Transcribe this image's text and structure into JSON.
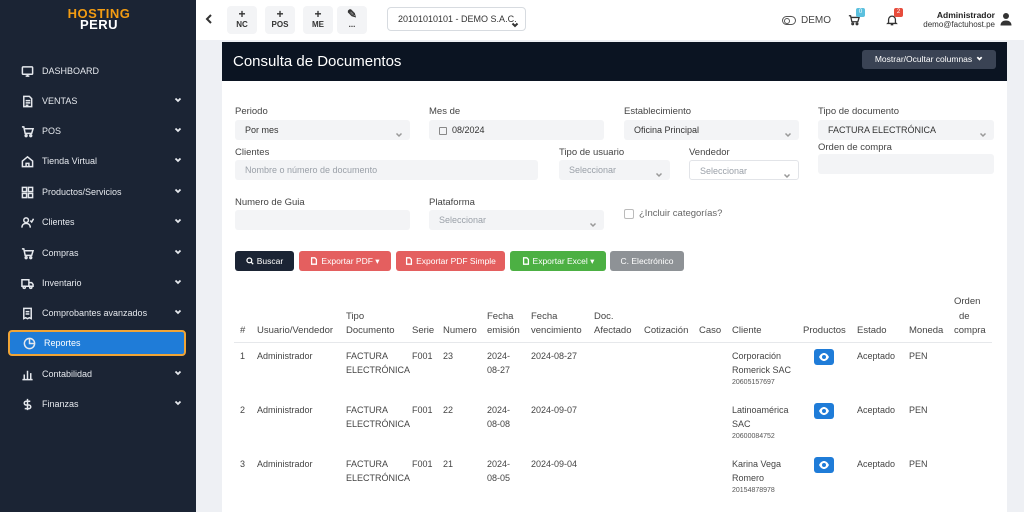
{
  "logo": {
    "line1": "HOSTING",
    "line2": "PERU"
  },
  "sidebar": {
    "items": [
      {
        "label": "DASHBOARD",
        "icon": "dashboard-icon"
      },
      {
        "label": "VENTAS",
        "icon": "document-icon"
      },
      {
        "label": "POS",
        "icon": "cart-icon"
      },
      {
        "label": "Tienda Virtual",
        "icon": "store-icon"
      },
      {
        "label": "Productos/Servicios",
        "icon": "grid-icon"
      },
      {
        "label": "Clientes",
        "icon": "users-icon"
      },
      {
        "label": "Compras",
        "icon": "cart-icon"
      },
      {
        "label": "Inventario",
        "icon": "truck-icon"
      },
      {
        "label": "Comprobantes avanzados",
        "icon": "receipt-icon"
      },
      {
        "label": "Reportes",
        "icon": "pie-chart-icon"
      },
      {
        "label": "Contabilidad",
        "icon": "bar-chart-icon"
      },
      {
        "label": "Finanzas",
        "icon": "dollar-icon"
      }
    ]
  },
  "topbar": {
    "quick": [
      {
        "plus": "+",
        "label": "NC"
      },
      {
        "plus": "+",
        "label": "POS"
      },
      {
        "plus": "+",
        "label": "ME"
      },
      {
        "plus": "✎",
        "label": "..."
      }
    ],
    "company": "20101010101 - DEMO S.A.C.",
    "demo_label": "DEMO",
    "cart_badge": "0",
    "bell_badge": "2",
    "user_name": "Administrador",
    "user_email": "demo@factuhost.pe",
    "colors": {
      "cart_badge": "#5bc0de",
      "bell_badge": "#e74c3c"
    }
  },
  "page": {
    "title": "Consulta de Documentos",
    "columns_button": "Mostrar/Ocultar columnas"
  },
  "filters": {
    "periodo": {
      "label": "Periodo",
      "value": "Por mes"
    },
    "mes": {
      "label": "Mes de",
      "value": "08/2024"
    },
    "establecimiento": {
      "label": "Establecimiento",
      "value": "Oficina Principal"
    },
    "tipo_documento": {
      "label": "Tipo de documento",
      "value": "FACTURA ELECTRÓNICA"
    },
    "clientes": {
      "label": "Clientes",
      "placeholder": "Nombre o número de documento"
    },
    "tipo_usuario": {
      "label": "Tipo de usuario",
      "placeholder": "Seleccionar"
    },
    "vendedor": {
      "label": "Vendedor",
      "placeholder": "Seleccionar"
    },
    "orden_compra": {
      "label": "Orden de compra",
      "value": ""
    },
    "numero_guia": {
      "label": "Numero de Guia",
      "value": ""
    },
    "plataforma": {
      "label": "Plataforma",
      "placeholder": "Seleccionar"
    },
    "incluir_categorias": {
      "label": "¿Incluir categorías?",
      "checked": false
    }
  },
  "actions": {
    "buscar": "Buscar",
    "exportar_pdf": "Exportar PDF",
    "exportar_pdf_simple": "Exportar PDF Simple",
    "exportar_excel": "Exportar Excel",
    "c_electronico": "C. Electrónico",
    "colors": {
      "buscar": "#1b2434",
      "pdf": "#e45f5f",
      "excel": "#4cb043",
      "electronico": "#8e9296"
    }
  },
  "table": {
    "headers": {
      "num": "#",
      "usuario": "Usuario/Vendedor",
      "tipo1": "Tipo",
      "tipo2": "Documento",
      "serie": "Serie",
      "numero": "Numero",
      "femision1": "Fecha",
      "femision2": "emisión",
      "fvenc1": "Fecha",
      "fvenc2": "vencimiento",
      "doc1": "Doc.",
      "doc2": "Afectado",
      "cotizacion": "Cotización",
      "caso": "Caso",
      "cliente": "Cliente",
      "productos": "Productos",
      "estado": "Estado",
      "moneda": "Moneda",
      "orden1": "Orden",
      "orden2": "de",
      "orden3": "compra"
    },
    "rows": [
      {
        "num": "1",
        "usuario": "Administrador",
        "tipo1": "FACTURA",
        "tipo2": "ELECTRÓNICA",
        "serie": "F001",
        "numero": "23",
        "fe1": "2024-",
        "fe2": "08-27",
        "fvenc": "2024-08-27",
        "cliente1": "Corporación",
        "cliente2": "Romerick SAC",
        "ruc": "20605157697",
        "estado": "Aceptado",
        "moneda": "PEN"
      },
      {
        "num": "2",
        "usuario": "Administrador",
        "tipo1": "FACTURA",
        "tipo2": "ELECTRÓNICA",
        "serie": "F001",
        "numero": "22",
        "fe1": "2024-",
        "fe2": "08-08",
        "fvenc": "2024-09-07",
        "cliente1": "Latinoamérica",
        "cliente2": "SAC",
        "ruc": "20600084752",
        "estado": "Aceptado",
        "moneda": "PEN"
      },
      {
        "num": "3",
        "usuario": "Administrador",
        "tipo1": "FACTURA",
        "tipo2": "ELECTRÓNICA",
        "serie": "F001",
        "numero": "21",
        "fe1": "2024-",
        "fe2": "08-05",
        "fvenc": "2024-09-04",
        "cliente1": "Karina Vega",
        "cliente2": "Romero",
        "ruc": "20154878978",
        "estado": "Aceptado",
        "moneda": "PEN"
      }
    ]
  }
}
